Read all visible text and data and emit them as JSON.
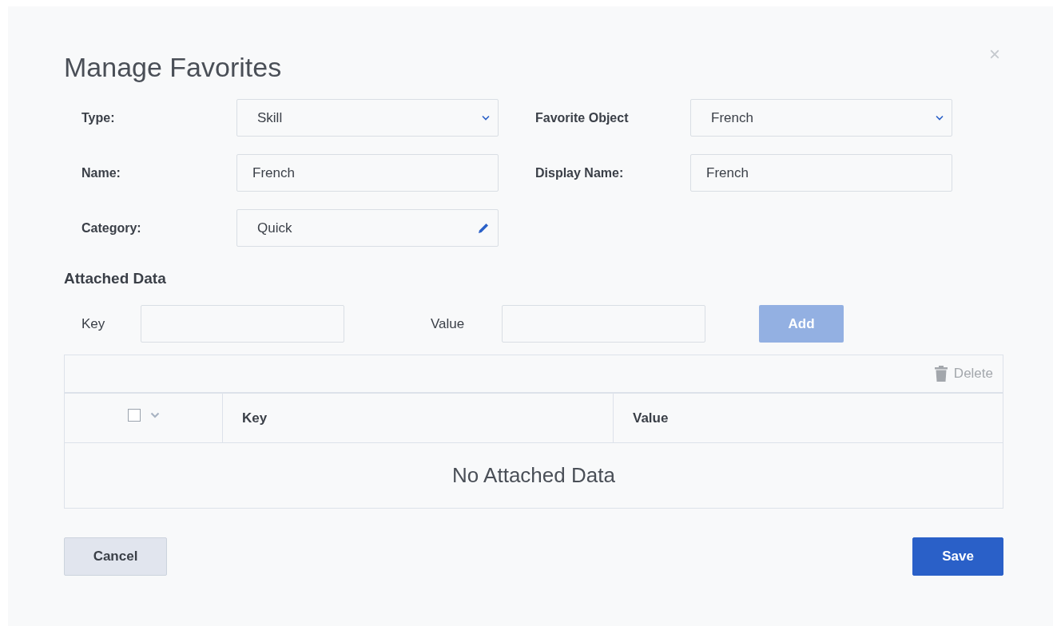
{
  "dialog": {
    "title": "Manage Favorites",
    "close": "×"
  },
  "fields": [
    {
      "label": "Type:",
      "kind": "select",
      "value": "Skill"
    },
    {
      "label": "Favorite Object",
      "kind": "select",
      "value": "French"
    },
    {
      "label": "Name:",
      "kind": "text",
      "value": "French"
    },
    {
      "label": "Display Name:",
      "kind": "text",
      "value": "French"
    },
    {
      "label": "Category:",
      "kind": "edit",
      "value": "Quick"
    }
  ],
  "attached_data": {
    "heading": "Attached Data",
    "key_label": "Key",
    "value_label": "Value",
    "add_button": {
      "label": "Add",
      "disabled": true
    },
    "delete_button": {
      "label": "Delete",
      "disabled": true
    },
    "select_all": {
      "checked": false
    },
    "columns": [
      "Key",
      "Value"
    ],
    "empty_message": "No Attached Data"
  },
  "buttons": [
    {
      "label": "Cancel",
      "kind": "secondary"
    },
    {
      "label": "Save",
      "kind": "primary"
    }
  ]
}
